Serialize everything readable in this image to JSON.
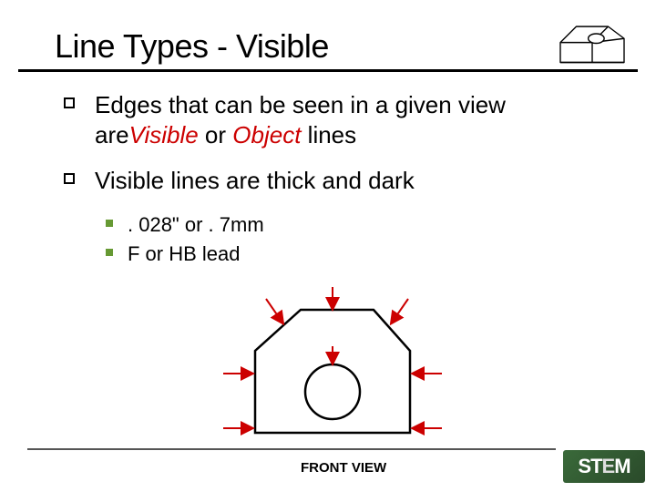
{
  "title": "Line Types - Visible",
  "bullets": {
    "item1_prefix": "Edges that can be seen in a given view are",
    "item1_em1": "Visible",
    "item1_mid": " or ",
    "item1_em2": "Object",
    "item1_suffix": " lines",
    "item2": "Visible lines are thick and dark"
  },
  "sub": {
    "s1": ". 028\" or . 7mm",
    "s2": "F or HB lead"
  },
  "front_label": "FRONT VIEW",
  "logo": {
    "text": "STEM",
    "letter_e": "E"
  }
}
